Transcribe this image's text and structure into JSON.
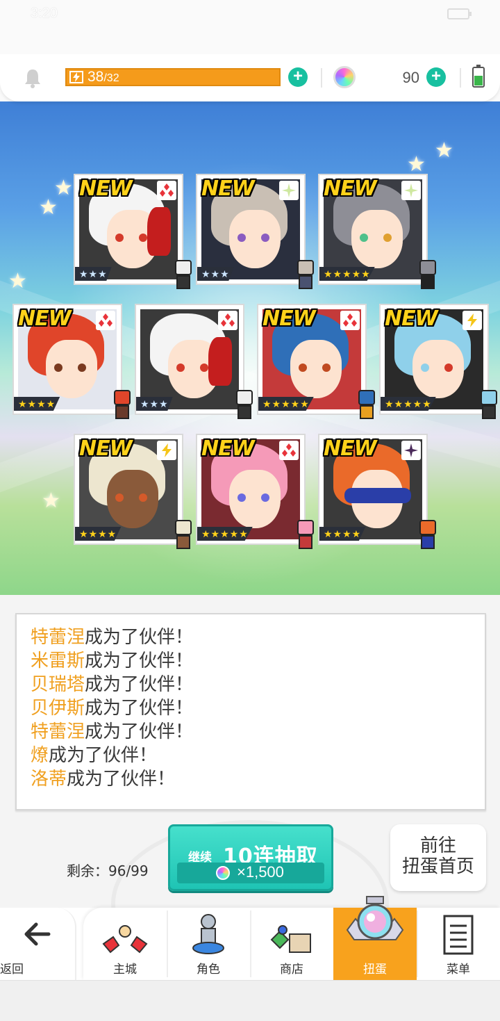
{
  "status_bar": {
    "time": "3:20"
  },
  "resource_bar": {
    "stamina_current": "38",
    "stamina_max": "/32",
    "gem_count": "90"
  },
  "cards": [
    {
      "new_label": "NEW",
      "element": "fire-diamond",
      "stars": "★★★",
      "rarity": 3
    },
    {
      "new_label": "NEW",
      "element": "light-sparkle",
      "stars": "★★★",
      "rarity": 3
    },
    {
      "new_label": "NEW",
      "element": "light-sparkle",
      "stars": "★★★★★",
      "rarity": 5
    },
    {
      "new_label": "NEW",
      "element": "fire-diamond",
      "stars": "★★★★",
      "rarity": 4
    },
    {
      "new_label": "",
      "element": "fire-diamond",
      "stars": "★★★",
      "rarity": 3
    },
    {
      "new_label": "NEW",
      "element": "fire-diamond",
      "stars": "★★★★★",
      "rarity": 5
    },
    {
      "new_label": "NEW",
      "element": "lightning-bolt",
      "stars": "★★★★★",
      "rarity": 5
    },
    {
      "new_label": "NEW",
      "element": "lightning-bolt",
      "stars": "★★★★",
      "rarity": 4
    },
    {
      "new_label": "NEW",
      "element": "fire-diamond",
      "stars": "★★★★★",
      "rarity": 5
    },
    {
      "new_label": "NEW",
      "element": "dark-star",
      "stars": "★★★★",
      "rarity": 4
    }
  ],
  "results": [
    {
      "name": "特蕾涅",
      "suffix": "成为了伙伴！"
    },
    {
      "name": "米雷斯",
      "suffix": "成为了伙伴！"
    },
    {
      "name": "贝瑞塔",
      "suffix": "成为了伙伴！"
    },
    {
      "name": "贝伊斯",
      "suffix": "成为了伙伴！"
    },
    {
      "name": "特蕾涅",
      "suffix": "成为了伙伴！"
    },
    {
      "name": "燎",
      "suffix": "成为了伙伴！"
    },
    {
      "name": "洛蒂",
      "suffix": "成为了伙伴！"
    }
  ],
  "gacha": {
    "remaining": "剩余：96/99",
    "continue_label": "继续",
    "pull_label": "10连抽取",
    "pull_cost": "×1,500",
    "goto_line1": "前往",
    "goto_line2": "扭蛋首页"
  },
  "nav": {
    "back": "返回",
    "items": [
      "主城",
      "角色",
      "商店",
      "扭蛋",
      "菜单"
    ],
    "active": "扭蛋"
  },
  "colors": {
    "accent_orange": "#f8a21d",
    "teal": "#1fc4b4",
    "name_orange": "#f0a020"
  }
}
